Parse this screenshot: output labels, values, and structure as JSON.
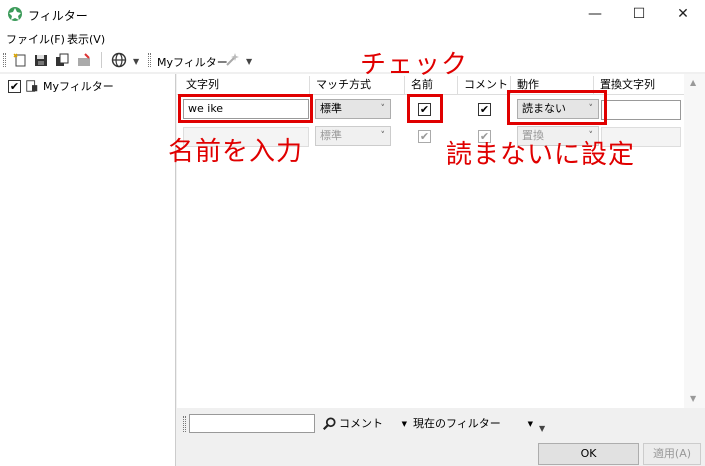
{
  "window": {
    "title": "フィルター"
  },
  "menu": [
    "ファイル(F)",
    "表示(V)"
  ],
  "toolbar": {
    "filter_label": "Myフィルター"
  },
  "tree": {
    "root_label": "Myフィルター",
    "checked": true
  },
  "grid": {
    "headers": [
      "文字列",
      "マッチ方式",
      "名前",
      "コメント",
      "動作",
      "置換文字列"
    ],
    "rows": [
      {
        "text": "we      ike",
        "match": "標準",
        "name_checked": true,
        "comment_checked": true,
        "action": "読まない",
        "replace": ""
      },
      {
        "text": "",
        "match": "標準",
        "name_checked": true,
        "comment_checked": true,
        "action": "置換",
        "replace": ""
      }
    ]
  },
  "annotations": {
    "check": "チェック",
    "enter_name": "名前を入力",
    "set_no_read": "読まないに設定"
  },
  "colors": {
    "annotation": "#e00000"
  },
  "bottom": {
    "search_value": "",
    "target": "コメント",
    "scope": "現在のフィルター"
  },
  "buttons": {
    "ok": "OK",
    "apply": "適用(A)"
  }
}
